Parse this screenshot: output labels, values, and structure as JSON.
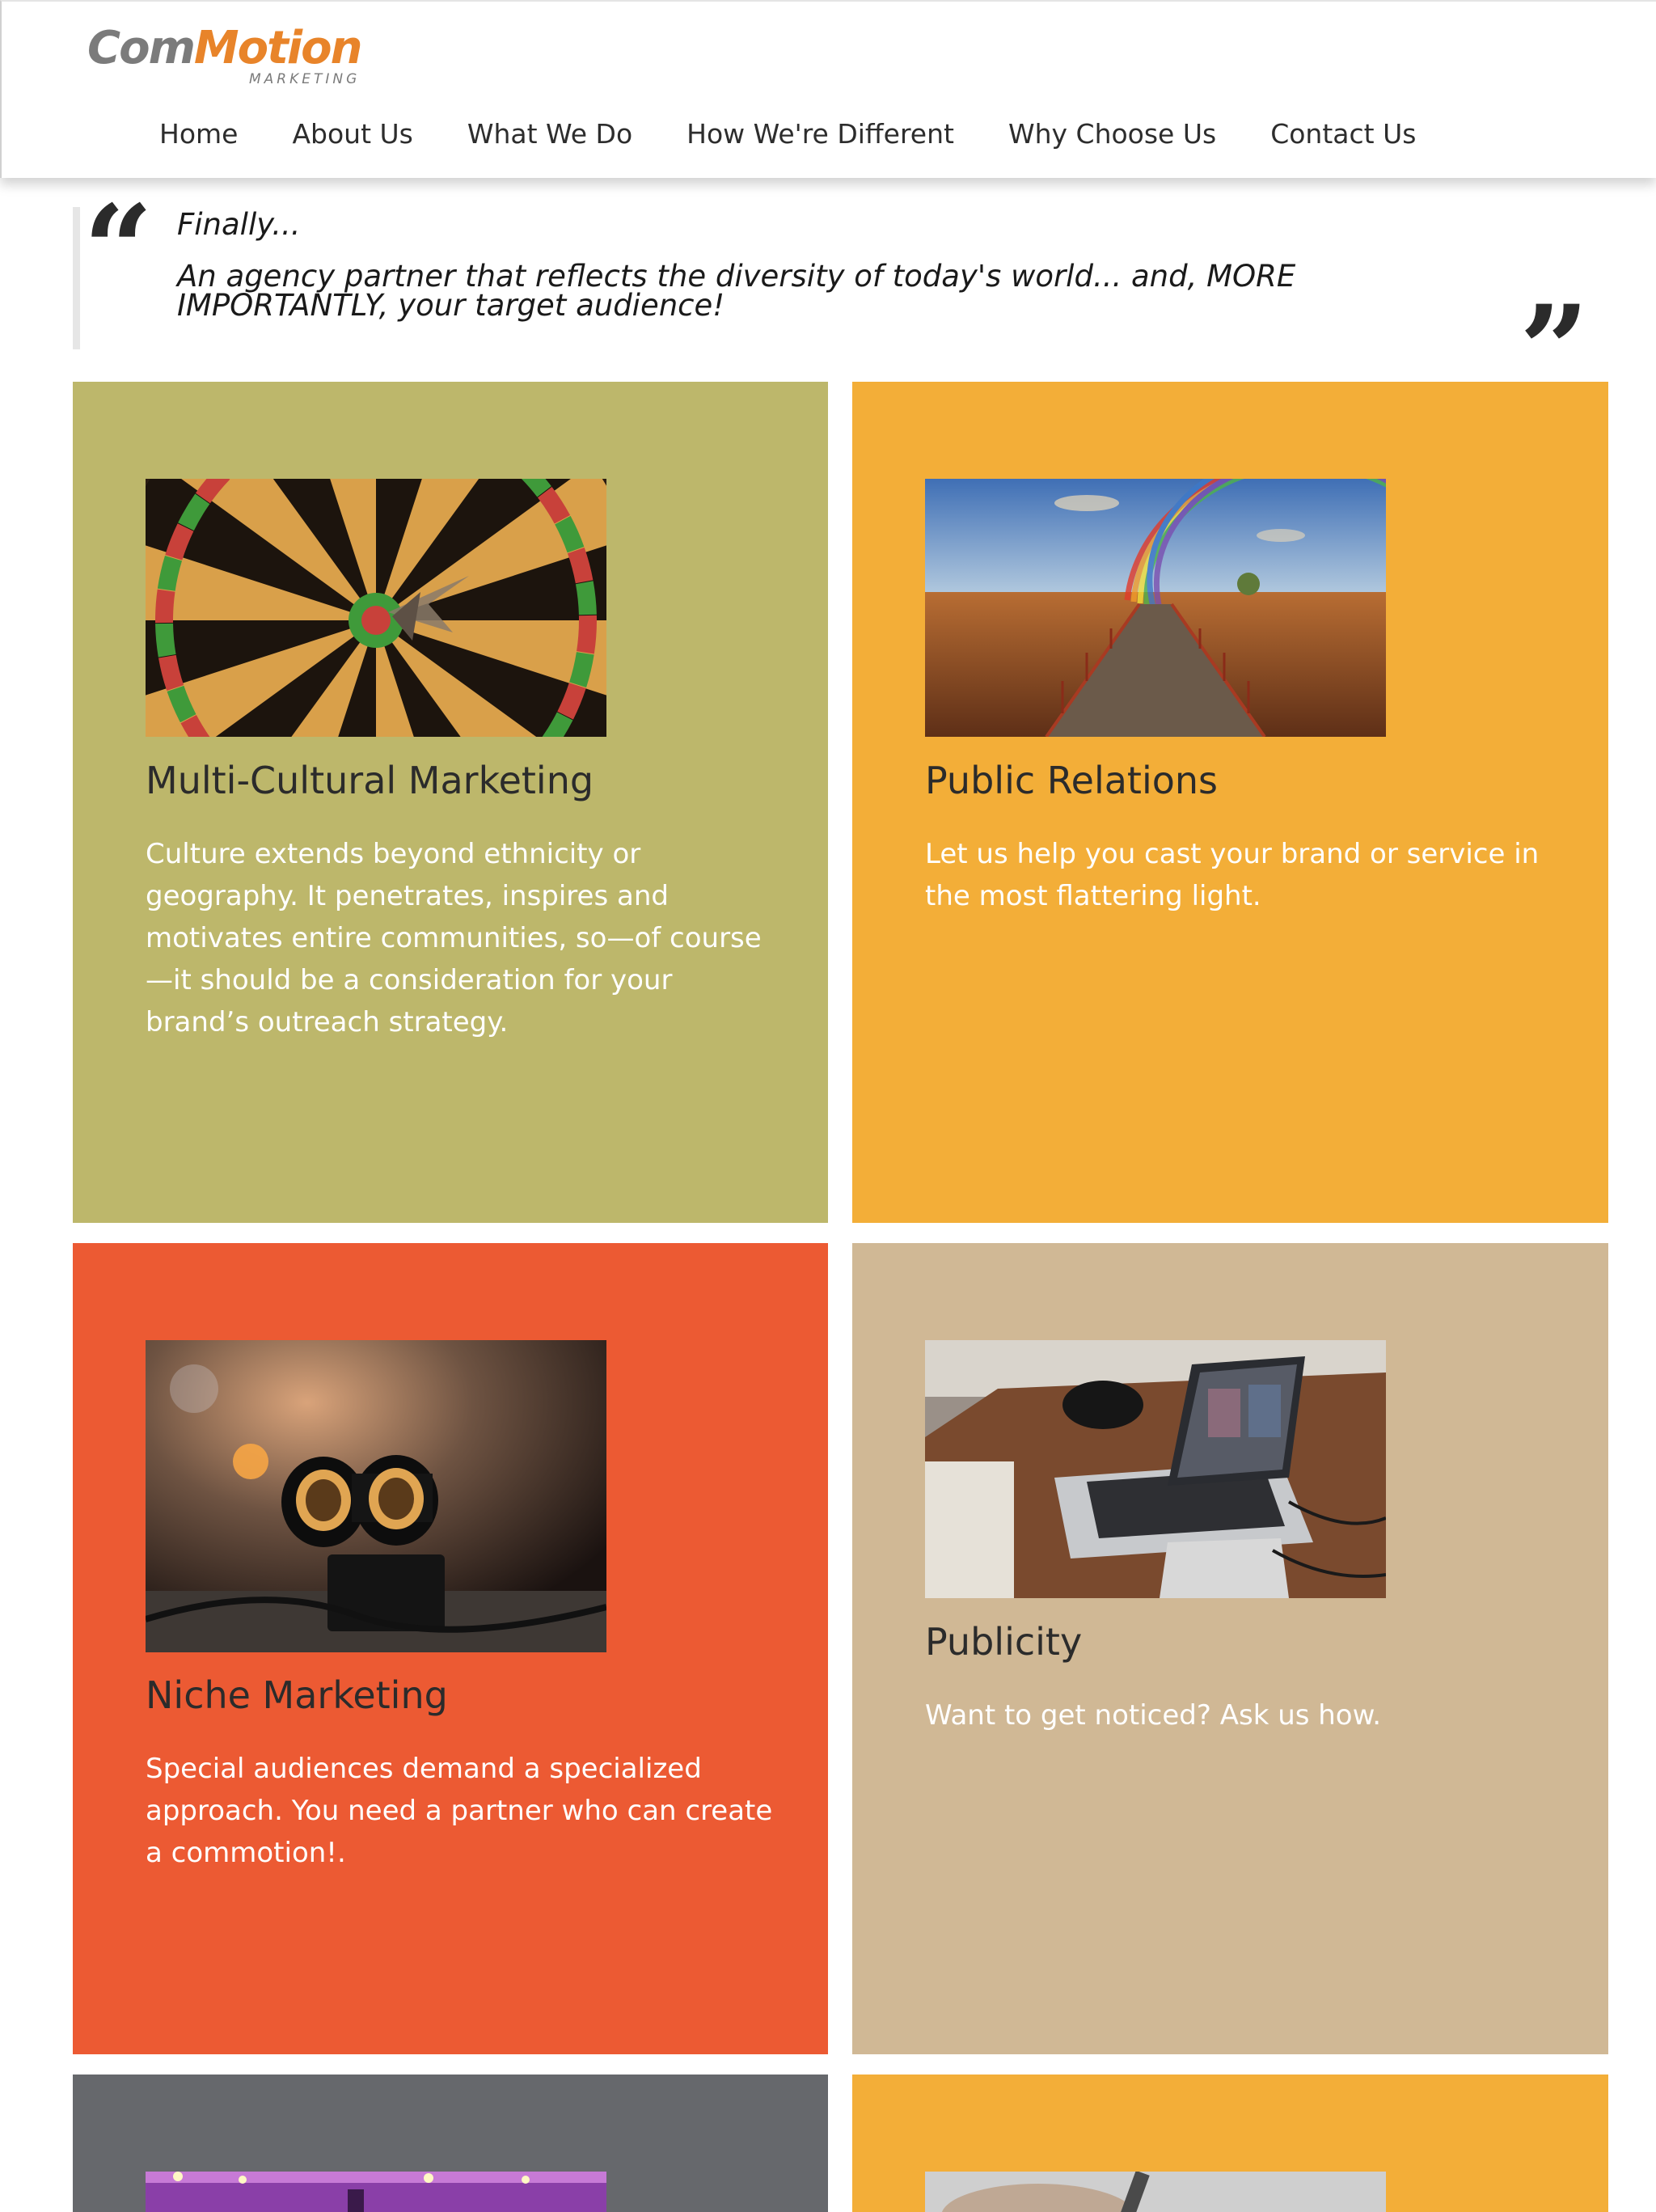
{
  "brand": {
    "name_part1": "Com",
    "name_part2": "Moti",
    "name_part3": "n",
    "tagline": "MARKETING",
    "colors": {
      "gray": "#7b7b7b",
      "orange": "#e8842a"
    }
  },
  "nav": {
    "items": [
      {
        "label": "Home"
      },
      {
        "label": "About Us"
      },
      {
        "label": "What We Do"
      },
      {
        "label": "How We're Different"
      },
      {
        "label": "Why Choose Us"
      },
      {
        "label": "Contact Us"
      }
    ]
  },
  "quote": {
    "open_mark": "“",
    "close_mark": "”",
    "lead": "Finally...",
    "body": "An agency partner that reflects the diversity of today's world... and, MORE IMPORTANTLY, your target audience!"
  },
  "cards": [
    {
      "title": "Multi-Cultural Marketing",
      "text": "Culture extends beyond ethnicity or geography. It penetrates, inspires and motivates entire communities, so—of course—it should be a consideration for your brand’s outreach strategy.",
      "color": "#bdb76b",
      "image": "dartboard-image"
    },
    {
      "title": "Public Relations",
      "text": "Let us help you cast your brand or service in the most flattering light.",
      "color": "#f3ae38",
      "image": "rainbow-boardwalk-image"
    },
    {
      "title": "Niche Marketing",
      "text": "Special audiences demand a specialized approach. You need a partner who can create a commotion!.",
      "color": "#ec5a33",
      "image": "binoculars-image"
    },
    {
      "title": "Publicity",
      "text": "Want to get noticed? Ask us how.",
      "color": "#d0b895",
      "image": "laptop-desk-image"
    },
    {
      "title": "",
      "text": "",
      "color": "#66686c",
      "image": "concert-image"
    },
    {
      "title": "",
      "text": "",
      "color": "#f3ae38",
      "image": "hand-pen-image"
    }
  ]
}
